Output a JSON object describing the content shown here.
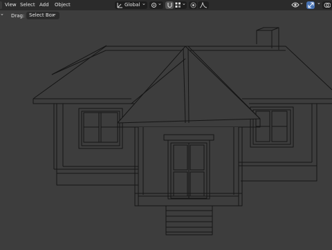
{
  "menu": {
    "view": "View",
    "select": "Select",
    "add": "Add",
    "object": "Object"
  },
  "header_tools": {
    "orientation": "Global",
    "chevron": "⌄"
  },
  "tool_settings": {
    "drag_label": "Drag:",
    "drag_value": "Select Box"
  },
  "colors": {
    "header_bg": "#2b2b2b",
    "viewport_bg": "#3d3d3d",
    "accent": "#4772b3",
    "wire": "#151515"
  },
  "icons": [
    "transform-orientation-icon",
    "pivot-icon",
    "snap-icon",
    "snap-increment-icon",
    "proportional-edit-icon",
    "falloff-icon",
    "visibility-icon",
    "gizmo-icon",
    "overlay-icon",
    "chevron-down-icon"
  ]
}
